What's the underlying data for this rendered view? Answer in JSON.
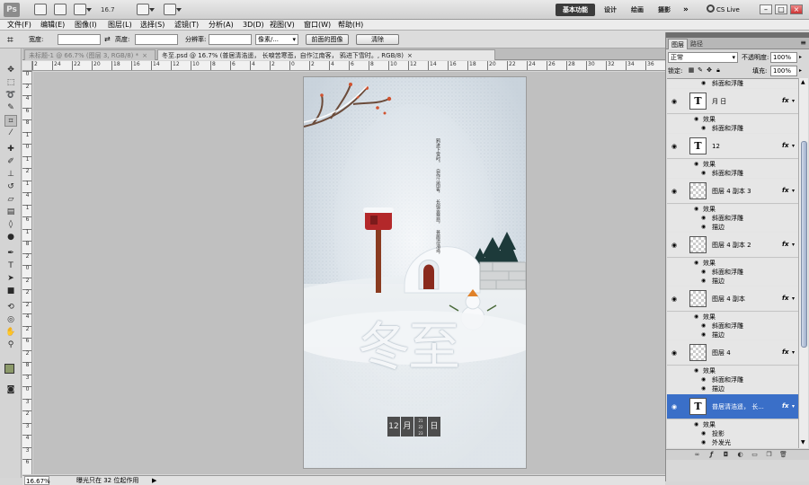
{
  "app": {
    "logo": "Ps",
    "zoom_value": "16.7",
    "workspaces": [
      "基本功能",
      "设计",
      "绘画",
      "摄影"
    ],
    "more": "»",
    "cs_live": "CS Live"
  },
  "menu": [
    "文件(F)",
    "编辑(E)",
    "图像(I)",
    "图层(L)",
    "选择(S)",
    "滤镜(T)",
    "分析(A)",
    "3D(D)",
    "视图(V)",
    "窗口(W)",
    "帮助(H)"
  ],
  "options": {
    "width_label": "宽度:",
    "height_label": "高度:",
    "resolution_label": "分辨率:",
    "unit_value": "像素/...",
    "front_image_button": "前面的图像",
    "clear_button": "清除"
  },
  "tabs": [
    {
      "title": "未标题-1 @ 66.7% (图层 3, RGB/8) *",
      "close": "×"
    },
    {
      "title": "冬至.psd @ 16.7% (普居清浩遥，  长唳苦寒悲，自作江南客，  鸦进下雪时。, RGB/8)",
      "close": "×"
    }
  ],
  "ruler": {
    "top": [
      "2",
      "24",
      "22",
      "20",
      "18",
      "16",
      "14",
      "12",
      "10",
      "8",
      "6",
      "4",
      "2",
      "0",
      "2",
      "4",
      "6",
      "8",
      "10",
      "12",
      "14",
      "16",
      "18",
      "20",
      "22",
      "24",
      "26",
      "28",
      "30",
      "32",
      "34",
      "36"
    ],
    "left": [
      "0",
      "2",
      "4",
      "6",
      "8",
      "1",
      "0",
      "1",
      "2",
      "1",
      "4",
      "1",
      "6",
      "1",
      "8",
      "2",
      "0",
      "2",
      "2",
      "2",
      "4",
      "2",
      "6",
      "2",
      "8",
      "3",
      "0",
      "3",
      "2",
      "3",
      "4",
      "3",
      "6"
    ]
  },
  "artwork": {
    "poem_lines": [
      "普居清浩遥，",
      "长唳苦寒悲，",
      "自作江南客，",
      "鸦进下雪时。"
    ],
    "big_title": "冬至",
    "date_month": "12",
    "date_month_unit": "月",
    "date_days": [
      "21",
      "22",
      "23"
    ],
    "date_day_unit": "日"
  },
  "status": {
    "zoom": "16.67%",
    "text": "曝光只在 32 位起作用",
    "arrow": "▶"
  },
  "panel": {
    "tabs": [
      "图层",
      "路径"
    ],
    "menu_icon": "≡",
    "blend_mode": "正常",
    "opacity_label": "不透明度:",
    "opacity_value": "100%",
    "lock_label": "锁定:",
    "fill_label": "填充:",
    "fill_value": "100%",
    "fx": "fx",
    "layers": [
      {
        "kind": "sub-only",
        "subs": [
          "斜面和浮雕"
        ]
      },
      {
        "kind": "text",
        "thumb": "T",
        "name": "月     日",
        "subs_head": "效果",
        "subs": [
          "斜面和浮雕"
        ]
      },
      {
        "kind": "text",
        "thumb": "T",
        "name": "12",
        "subs_head": "效果",
        "subs": [
          "斜面和浮雕"
        ]
      },
      {
        "kind": "raster",
        "name": "图层 4 副本 3",
        "subs_head": "效果",
        "subs": [
          "斜面和浮雕",
          "描边"
        ]
      },
      {
        "kind": "raster",
        "name": "图层 4 副本 2",
        "subs_head": "效果",
        "subs": [
          "斜面和浮雕",
          "描边"
        ]
      },
      {
        "kind": "raster",
        "name": "图层 4 副本",
        "subs_head": "效果",
        "subs": [
          "斜面和浮雕",
          "描边"
        ]
      },
      {
        "kind": "raster",
        "name": "图层 4",
        "subs_head": "效果",
        "subs": [
          "斜面和浮雕",
          "描边"
        ]
      },
      {
        "kind": "text",
        "thumb": "T",
        "name": "普居清浩遥，   长...",
        "selected": true,
        "subs_head": "效果",
        "subs": [
          "投影",
          "外发光"
        ]
      }
    ]
  },
  "colors": {
    "foreground": "#8c9a6a",
    "background": "#dfe8d0",
    "selection": "#3a6fc8"
  }
}
